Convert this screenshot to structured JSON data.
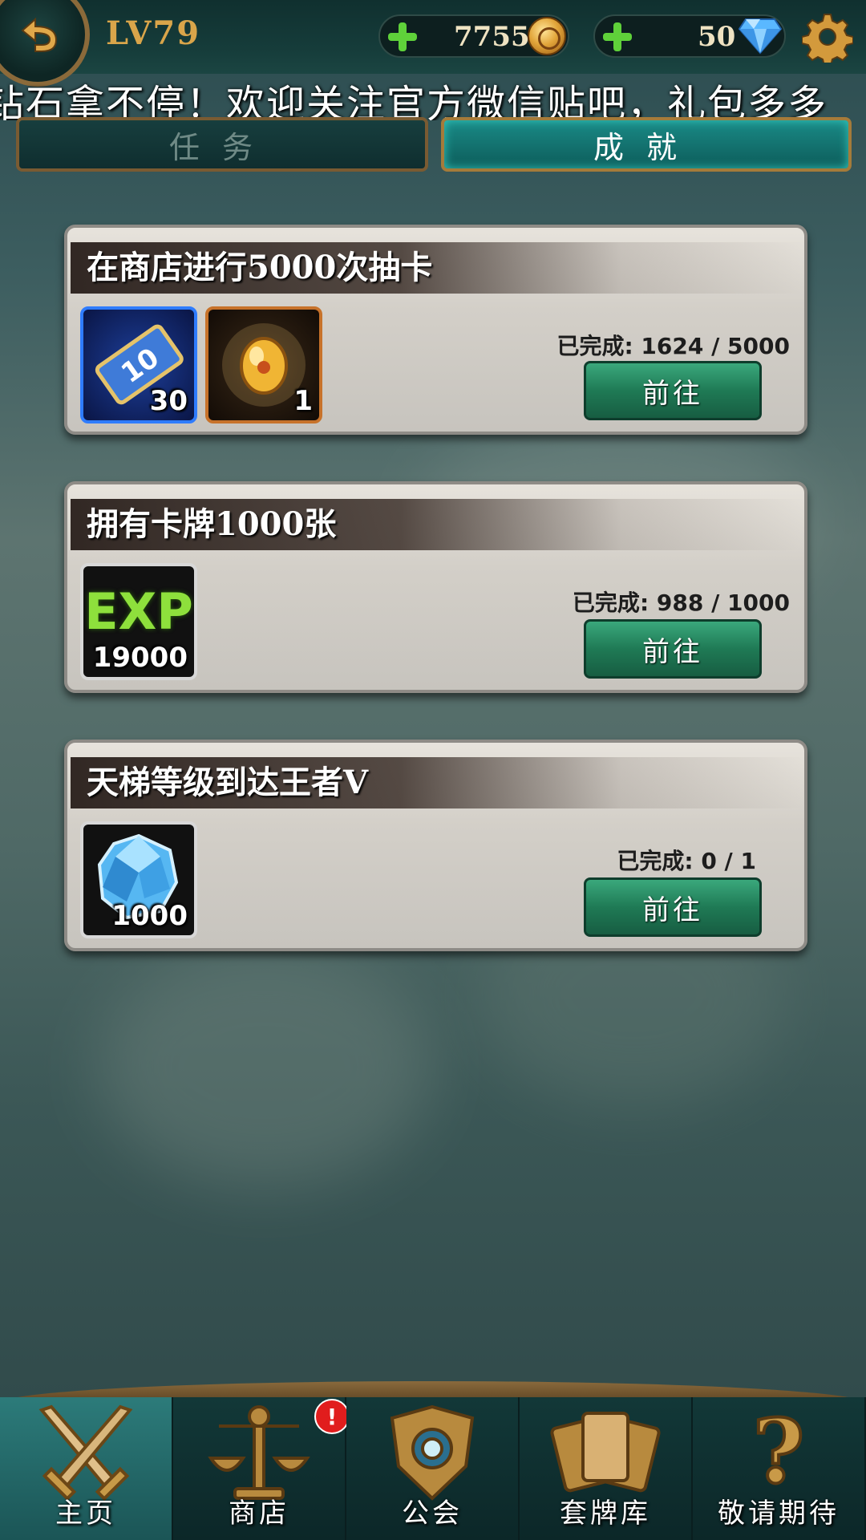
{
  "header": {
    "level": "LV79",
    "gold": "7755",
    "diamonds": "50",
    "icons": [
      "back-arrow-icon",
      "plus-icon",
      "gold-coin-icon",
      "diamond-icon",
      "gear-icon"
    ]
  },
  "marquee": {
    "text": "钻石拿不停！欢迎关注官方微信贴吧，礼包多多"
  },
  "tabs": [
    {
      "label": "任务",
      "active": false
    },
    {
      "label": "成就",
      "active": true
    }
  ],
  "achievements": [
    {
      "title": "在商店进行5000次抽卡",
      "progress_label": "已完成",
      "progress": "1624 / 5000",
      "button": "前往",
      "rewards": [
        {
          "icon": "ten-draw-ticket-icon",
          "qty": "30"
        },
        {
          "icon": "golden-egg-icon",
          "qty": "1"
        }
      ]
    },
    {
      "title": "拥有卡牌1000张",
      "progress_label": "已完成",
      "progress": "988 / 1000",
      "button": "前往",
      "rewards": [
        {
          "icon": "exp-icon",
          "icon_text": "EXP",
          "qty": "19000"
        }
      ]
    },
    {
      "title": "天梯等级到达王者Ⅴ",
      "progress_label": "已完成",
      "progress": "0 / 1",
      "button": "前往",
      "rewards": [
        {
          "icon": "blue-crystal-icon",
          "qty": "1000"
        }
      ]
    }
  ],
  "bottom_nav": {
    "items": [
      {
        "label": "主页",
        "icon": "crossed-swords-icon",
        "active": true
      },
      {
        "label": "商店",
        "icon": "scales-icon",
        "badge": "!"
      },
      {
        "label": "公会",
        "icon": "guild-crest-icon"
      },
      {
        "label": "套牌库",
        "icon": "card-deck-icon"
      },
      {
        "label": "敬请期待",
        "icon": "question-mark-icon"
      }
    ]
  },
  "colors": {
    "accent_gold": "#d9a54a",
    "go_button": "#1f7a55",
    "tab_active": "#1a8a86",
    "badge_red": "#e11d1d"
  }
}
